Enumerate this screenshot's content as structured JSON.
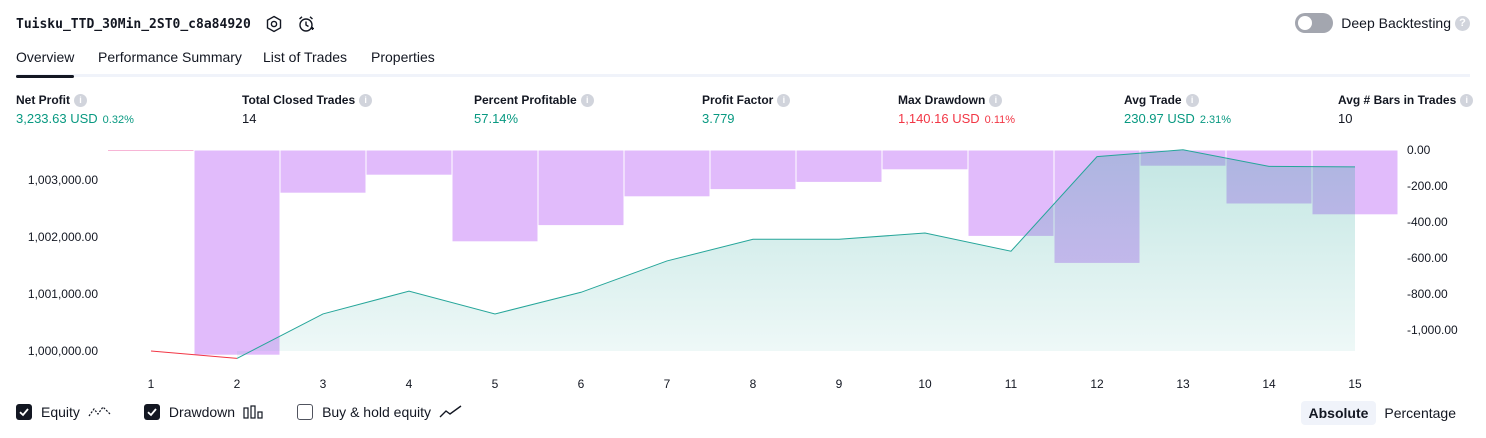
{
  "header": {
    "strategy_name": "Tuisku_TTD_30Min_2ST0_c8a84920",
    "deep_backtesting_label": "Deep Backtesting",
    "help_glyph": "?"
  },
  "tabs": [
    {
      "label": "Overview",
      "active": true
    },
    {
      "label": "Performance Summary"
    },
    {
      "label": "List of Trades"
    },
    {
      "label": "Properties"
    }
  ],
  "metrics": [
    {
      "label": "Net Profit",
      "value": "3,233.63 USD",
      "pct": "0.32%",
      "color": "green"
    },
    {
      "label": "Total Closed Trades",
      "value": "14",
      "pct": "",
      "color": "black"
    },
    {
      "label": "Percent Profitable",
      "value": "57.14%",
      "pct": "",
      "color": "green"
    },
    {
      "label": "Profit Factor",
      "value": "3.779",
      "pct": "",
      "color": "green"
    },
    {
      "label": "Max Drawdown",
      "value": "1,140.16 USD",
      "pct": "0.11%",
      "color": "red"
    },
    {
      "label": "Avg Trade",
      "value": "230.97 USD",
      "pct": "2.31%",
      "color": "green"
    },
    {
      "label": "Avg # Bars in Trades",
      "value": "10",
      "pct": "",
      "color": "black"
    }
  ],
  "chart_data": {
    "type": "line",
    "x": [
      1,
      2,
      3,
      4,
      5,
      6,
      7,
      8,
      9,
      10,
      11,
      12,
      13,
      14,
      15
    ],
    "equity": [
      1000000,
      999870,
      1000650,
      1001050,
      1000650,
      1001030,
      1001580,
      1001960,
      1001960,
      1002070,
      1001750,
      1003410,
      1003530,
      1003240,
      1003230
    ],
    "drawdown": [
      0,
      -1140,
      -240,
      -140,
      -510,
      -420,
      -260,
      -220,
      -180,
      -110,
      -480,
      -630,
      -90,
      -300,
      -360
    ],
    "y_left_ticks": [
      "1,000,000.00",
      "1,001,000.00",
      "1,002,000.00",
      "1,003,000.00"
    ],
    "y_left_values": [
      1000000,
      1001000,
      1002000,
      1003000
    ],
    "y_right_ticks": [
      "0.00",
      "-200.00",
      "-400.00",
      "-600.00",
      "-800.00",
      "-1,000.00"
    ],
    "y_right_values": [
      0,
      -200,
      -400,
      -600,
      -800,
      -1000
    ],
    "colors": {
      "equity_line": "#26a69a",
      "equity_fill": "#26a69a",
      "equity_negative": "#f23645",
      "drawdown_fill": "#e1bbfb"
    }
  },
  "legend": {
    "equity": {
      "label": "Equity",
      "checked": true
    },
    "drawdown": {
      "label": "Drawdown",
      "checked": true
    },
    "buyhold": {
      "label": "Buy & hold equity",
      "checked": false
    }
  },
  "mode": {
    "absolute": "Absolute",
    "percentage": "Percentage"
  }
}
